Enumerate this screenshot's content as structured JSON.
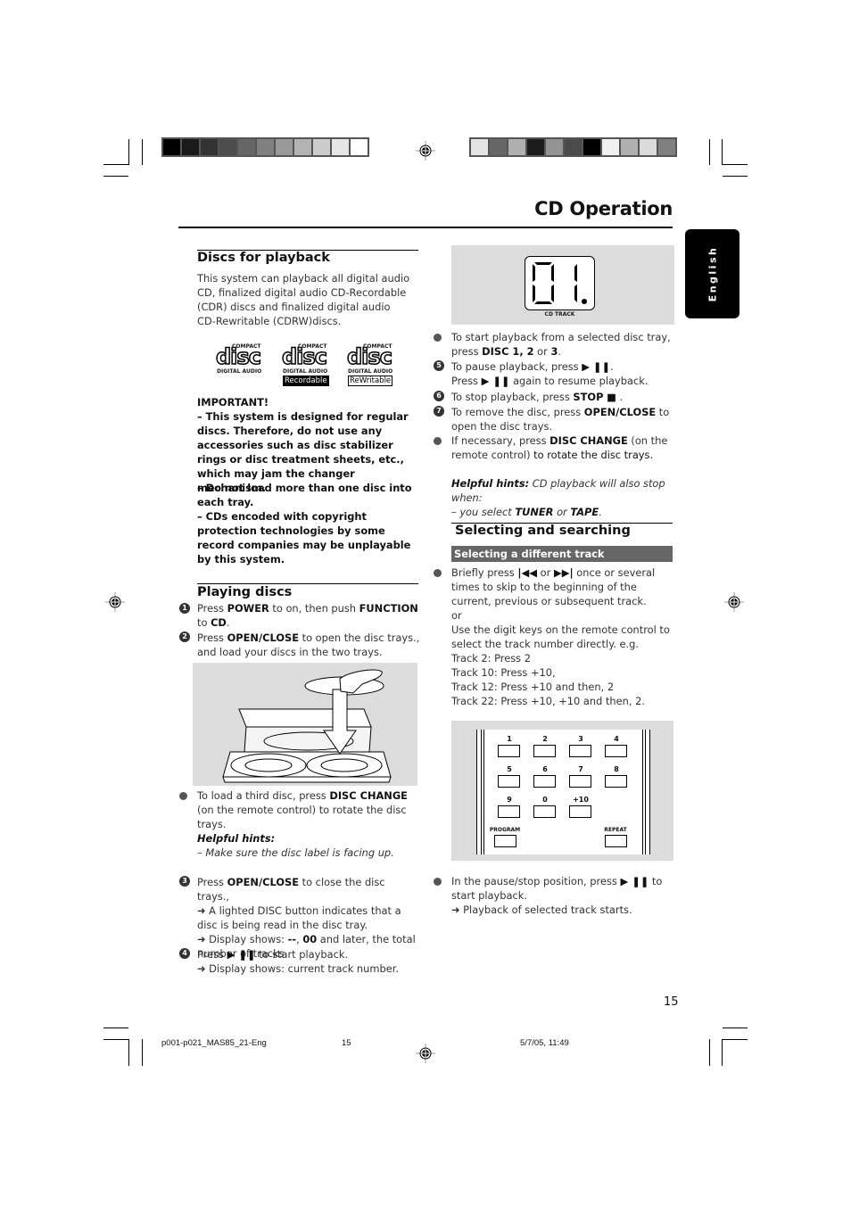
{
  "print_marks": {
    "colorbar_left": [
      "#000000",
      "#1a1a1a",
      "#333333",
      "#4d4d4d",
      "#666666",
      "#808080",
      "#999999",
      "#b3b3b3",
      "#cccccc",
      "#e6e6e6",
      "#ffffff"
    ],
    "colorbar_right": [
      "#e3e3e3",
      "#666666",
      "#b0b0b0",
      "#1c1c1c",
      "#939393",
      "#4b4b4b",
      "#000000",
      "#f0f0f0",
      "#b0b0b0",
      "#dadada",
      "#808080"
    ]
  },
  "header": {
    "title": "CD Operation",
    "language_tab": "English"
  },
  "discs_for_playback": {
    "heading": "Discs for playback",
    "intro": "This system can playback all digital audio CD, finalized digital audio CD-Recordable (CDR) discs and finalized digital audio CD-Rewritable (CDRW)discs.",
    "logos": [
      {
        "top": "COMPACT",
        "main": "disc",
        "bottom": "DIGITAL AUDIO",
        "badge": ""
      },
      {
        "top": "COMPACT",
        "main": "disc",
        "bottom": "DIGITAL AUDIO",
        "badge": "Recordable"
      },
      {
        "top": "COMPACT",
        "main": "disc",
        "bottom": "DIGITAL AUDIO",
        "badge": "ReWritable"
      }
    ],
    "important_title": "IMPORTANT!",
    "important_items": [
      "–  This system is designed for regular discs. Therefore, do not use any accessories such as disc stabilizer rings or disc treatment sheets, etc., which may jam the changer mechanism.",
      "–  Do not load more than one disc into each tray.",
      "–  CDs encoded with copyright protection technologies by some record companies may be unplayable by this system."
    ]
  },
  "playing_discs": {
    "heading": "Playing discs",
    "step1": {
      "num": "1",
      "pre": "Press ",
      "b1": "POWER",
      "mid": " to on, then push ",
      "b2": "FUNCTION",
      "mid2": " to ",
      "b3": "CD",
      "post": "."
    },
    "step2": {
      "num": "2",
      "pre": "Press ",
      "b1": "OPEN/CLOSE",
      "post": "  to  open the disc trays., and load your discs in the two trays."
    },
    "bullet_third_disc": {
      "pre": "To load a third disc, press ",
      "b1": "DISC CHANGE",
      "post": " (on the remote control) to rotate the disc trays."
    },
    "hints_title": "Helpful hints:",
    "hints_text": "–  Make sure the disc label is facing up.",
    "step3": {
      "num": "3",
      "pre": "Press ",
      "b1": "OPEN/CLOSE",
      "post": "  to  close the disc trays.,",
      "arrow1": "➜ A lighted DISC button indicates that a disc is being read in the disc tray.",
      "arrow2_pre": "➜ Display shows: ",
      "arrow2_b": "--",
      "arrow2_sep": ", ",
      "arrow2_b2": "00",
      "arrow2_post": " and later, the total number of tracks."
    },
    "step4": {
      "num": "4",
      "pre": "Press ",
      "icon": "▶ ❚❚",
      "post": "  to start playback.",
      "arrow": "➜ Display shows: current track number."
    }
  },
  "display_panel": {
    "digits": "01",
    "label": "CD TRACK"
  },
  "right_steps": {
    "bullet_disc_select": {
      "pre": "To start playback from a selected disc tray, press ",
      "b1": "DISC 1, 2",
      "mid": " or  ",
      "b2": "3",
      "post": "."
    },
    "step5": {
      "num": "5",
      "pre": "To pause playback, press ",
      "icon": "▶ ❚❚",
      "post": ".",
      "line2_pre": "Press ",
      "line2_post": "  again to resume playback."
    },
    "step6": {
      "num": "6",
      "pre": "To stop playback, press ",
      "b1": "STOP",
      "icon": "■",
      "post": " ."
    },
    "step7": {
      "num": "7",
      "pre": "To remove the disc, press ",
      "b1": "OPEN/CLOSE",
      "post": "  to open the disc trays."
    },
    "bullet_disc_change": {
      "pre": " If necessary, press ",
      "b1": "DISC CHANGE",
      "mid": " (on the remote control) ",
      "post": "to rotate the disc trays."
    },
    "hints_title": "Helpful hints:",
    "hints_text1": " CD playback will also stop when:",
    "hints_text2_pre": "–  you select ",
    "hints_b1": "TUNER",
    "hints_mid": " or ",
    "hints_b2": "TAPE",
    "hints_post": "."
  },
  "selecting": {
    "heading": "Selecting and searching",
    "subheading": "Selecting a different track",
    "bullet1": {
      "pre": "Briefly press ",
      "icon_prev": "|◀◀",
      "mid": "  or  ",
      "icon_next": "▶▶|",
      "post": " once or several times to skip to the beginning of the current, previous or subsequent track."
    },
    "or": " or",
    "digit_intro": "Use the digit keys on the remote control to select the track number directly. e.g.",
    "examples": [
      "Track 2: Press 2",
      "Track 10: Press +10,",
      "Track 12: Press +10 and then, 2",
      "Track 22: Press +10, +10 and then, 2."
    ],
    "remote_keys": [
      "1",
      "2",
      "3",
      "4",
      "5",
      "6",
      "7",
      "8",
      "9",
      "0",
      "+10",
      "PROGRAM",
      "REPEAT"
    ],
    "bullet2": {
      "pre": "In the pause/stop position, press  ",
      "icon": "▶ ❚❚",
      "post": "  to start playback.",
      "arrow": "➜ Playback of selected track starts."
    }
  },
  "footer": {
    "page_number": "15",
    "file": "p001-p021_MAS85_21-Eng",
    "slug_page": "15",
    "date": "5/7/05, 11:49"
  }
}
